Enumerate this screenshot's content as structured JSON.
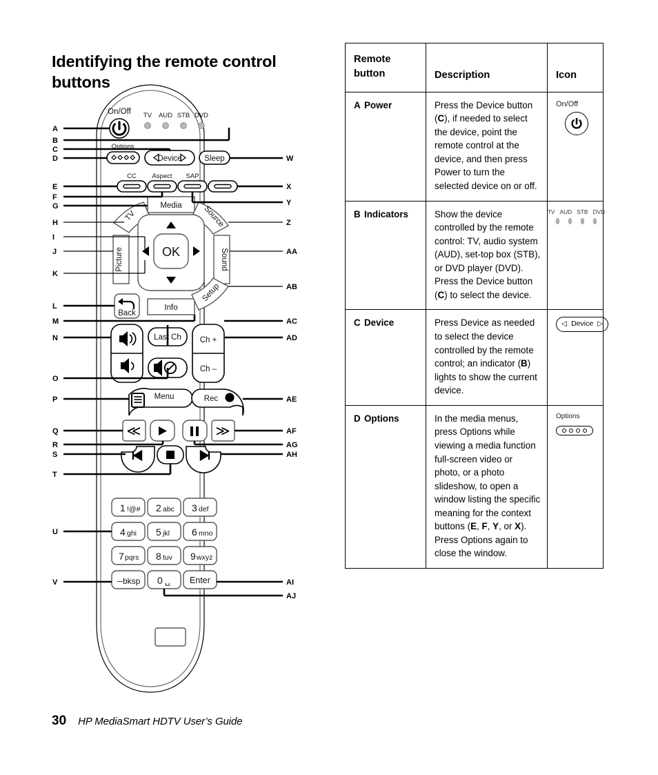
{
  "page": {
    "title": "Identifying the remote control buttons",
    "number": "30",
    "footer_text": "HP MediaSmart HDTV User’s Guide"
  },
  "table": {
    "headers": {
      "col1_line1": "Remote",
      "col1_line2": "button",
      "col2": "Description",
      "col3": "Icon"
    },
    "rows": [
      {
        "letter": "A",
        "name": "Power",
        "description_parts": [
          "Press the Device button (",
          "C",
          "), if needed to select the device, point the remote control at the device, and then press Power to turn the selected device on or off."
        ],
        "icon": {
          "type": "power-button-icon",
          "label": "On/Off",
          "glyph": "⏻"
        }
      },
      {
        "letter": "B",
        "name": "Indicators",
        "description_parts": [
          "Show the device controlled by the remote control: TV, audio system (AUD), set-top box (STB), or DVD player (DVD). Press the Device button (",
          "C",
          ") to select the device."
        ],
        "icon": {
          "type": "indicator-leds-icon",
          "labels": [
            "TV",
            "AUD",
            "STB",
            "DVD"
          ]
        }
      },
      {
        "letter": "C",
        "name": "Device",
        "description_parts": [
          "Press Device as needed to select the device controlled by the remote control; an indicator (",
          "B",
          ") lights to show the current device."
        ],
        "icon": {
          "type": "device-rocker-icon",
          "label": "Device",
          "left_glyph": "◁",
          "right_glyph": "▷"
        }
      },
      {
        "letter": "D",
        "name": "Options",
        "description_parts": [
          "In the media menus, press Options while viewing a media function full-screen video or photo, or a photo slideshow, to open a window listing the specific meaning for the context buttons (",
          "E",
          ", ",
          "F",
          ", ",
          "Y",
          ", or ",
          "X",
          "). Press Options again to close the window."
        ],
        "icon": {
          "type": "options-button-icon",
          "label": "Options",
          "dot_count": 4
        }
      }
    ]
  },
  "remote": {
    "top": {
      "power_label": "On/Off",
      "indicator_labels": [
        "TV",
        "AUD",
        "STB",
        "DVD"
      ],
      "options_label": "Options",
      "device_label": "Device",
      "device_left_glyph": "◁",
      "device_right_glyph": "▷",
      "sleep_label": "Sleep"
    },
    "context_row": {
      "cc_label": "CC",
      "aspect_label": "Aspect",
      "sap_label": "SAP",
      "fourth_label": ""
    },
    "navigation": {
      "tv_label": "TV",
      "media_label": "Media",
      "source_label": "Source",
      "picture_label": "Picture",
      "ok_label": "OK",
      "sound_label": "Sound",
      "back_label": "Back",
      "info_label": "Info",
      "setup_label": "Setup",
      "up_glyph": "▲",
      "down_glyph": "▼",
      "left_glyph": "◀",
      "right_glyph": "▶"
    },
    "volume_channel": {
      "volume_up_glyph": "🔊",
      "volume_down_glyph": "🔉",
      "last_ch_label": "Last Ch",
      "mute_glyph": "🔇",
      "ch_up_label": "Ch +",
      "ch_down_label": "Ch –"
    },
    "transport": {
      "menu_label": "Menu",
      "rec_label": "Rec",
      "rewind_glyph": "≪",
      "play_glyph": "▶",
      "pause_glyph": "▐▐",
      "fastforward_glyph": "≫",
      "prev_glyph": "⏮",
      "stop_glyph": "■",
      "next_glyph": "⏭"
    },
    "keypad": [
      {
        "digit": "1",
        "letters": "!@#"
      },
      {
        "digit": "2",
        "letters": "abc"
      },
      {
        "digit": "3",
        "letters": "def"
      },
      {
        "digit": "4",
        "letters": "ghi"
      },
      {
        "digit": "5",
        "letters": "jkl"
      },
      {
        "digit": "6",
        "letters": "mno"
      },
      {
        "digit": "7",
        "letters": "pqrs"
      },
      {
        "digit": "8",
        "letters": "tuv"
      },
      {
        "digit": "9",
        "letters": "wxyz"
      },
      {
        "digit": "–",
        "letters": "bksp"
      },
      {
        "digit": "0",
        "letters": "␣"
      },
      {
        "digit": "",
        "letters": "Enter"
      }
    ],
    "callouts_left": [
      "A",
      "B",
      "C",
      "D",
      "E",
      "F",
      "G",
      "H",
      "I",
      "J",
      "K",
      "L",
      "M",
      "N",
      "O",
      "P",
      "Q",
      "R",
      "S",
      "T",
      "U",
      "V"
    ],
    "callouts_right": [
      "W",
      "X",
      "Y",
      "Z",
      "AA",
      "AB",
      "AC",
      "AD",
      "AE",
      "AF",
      "AG",
      "AH",
      "AI",
      "AJ"
    ]
  }
}
